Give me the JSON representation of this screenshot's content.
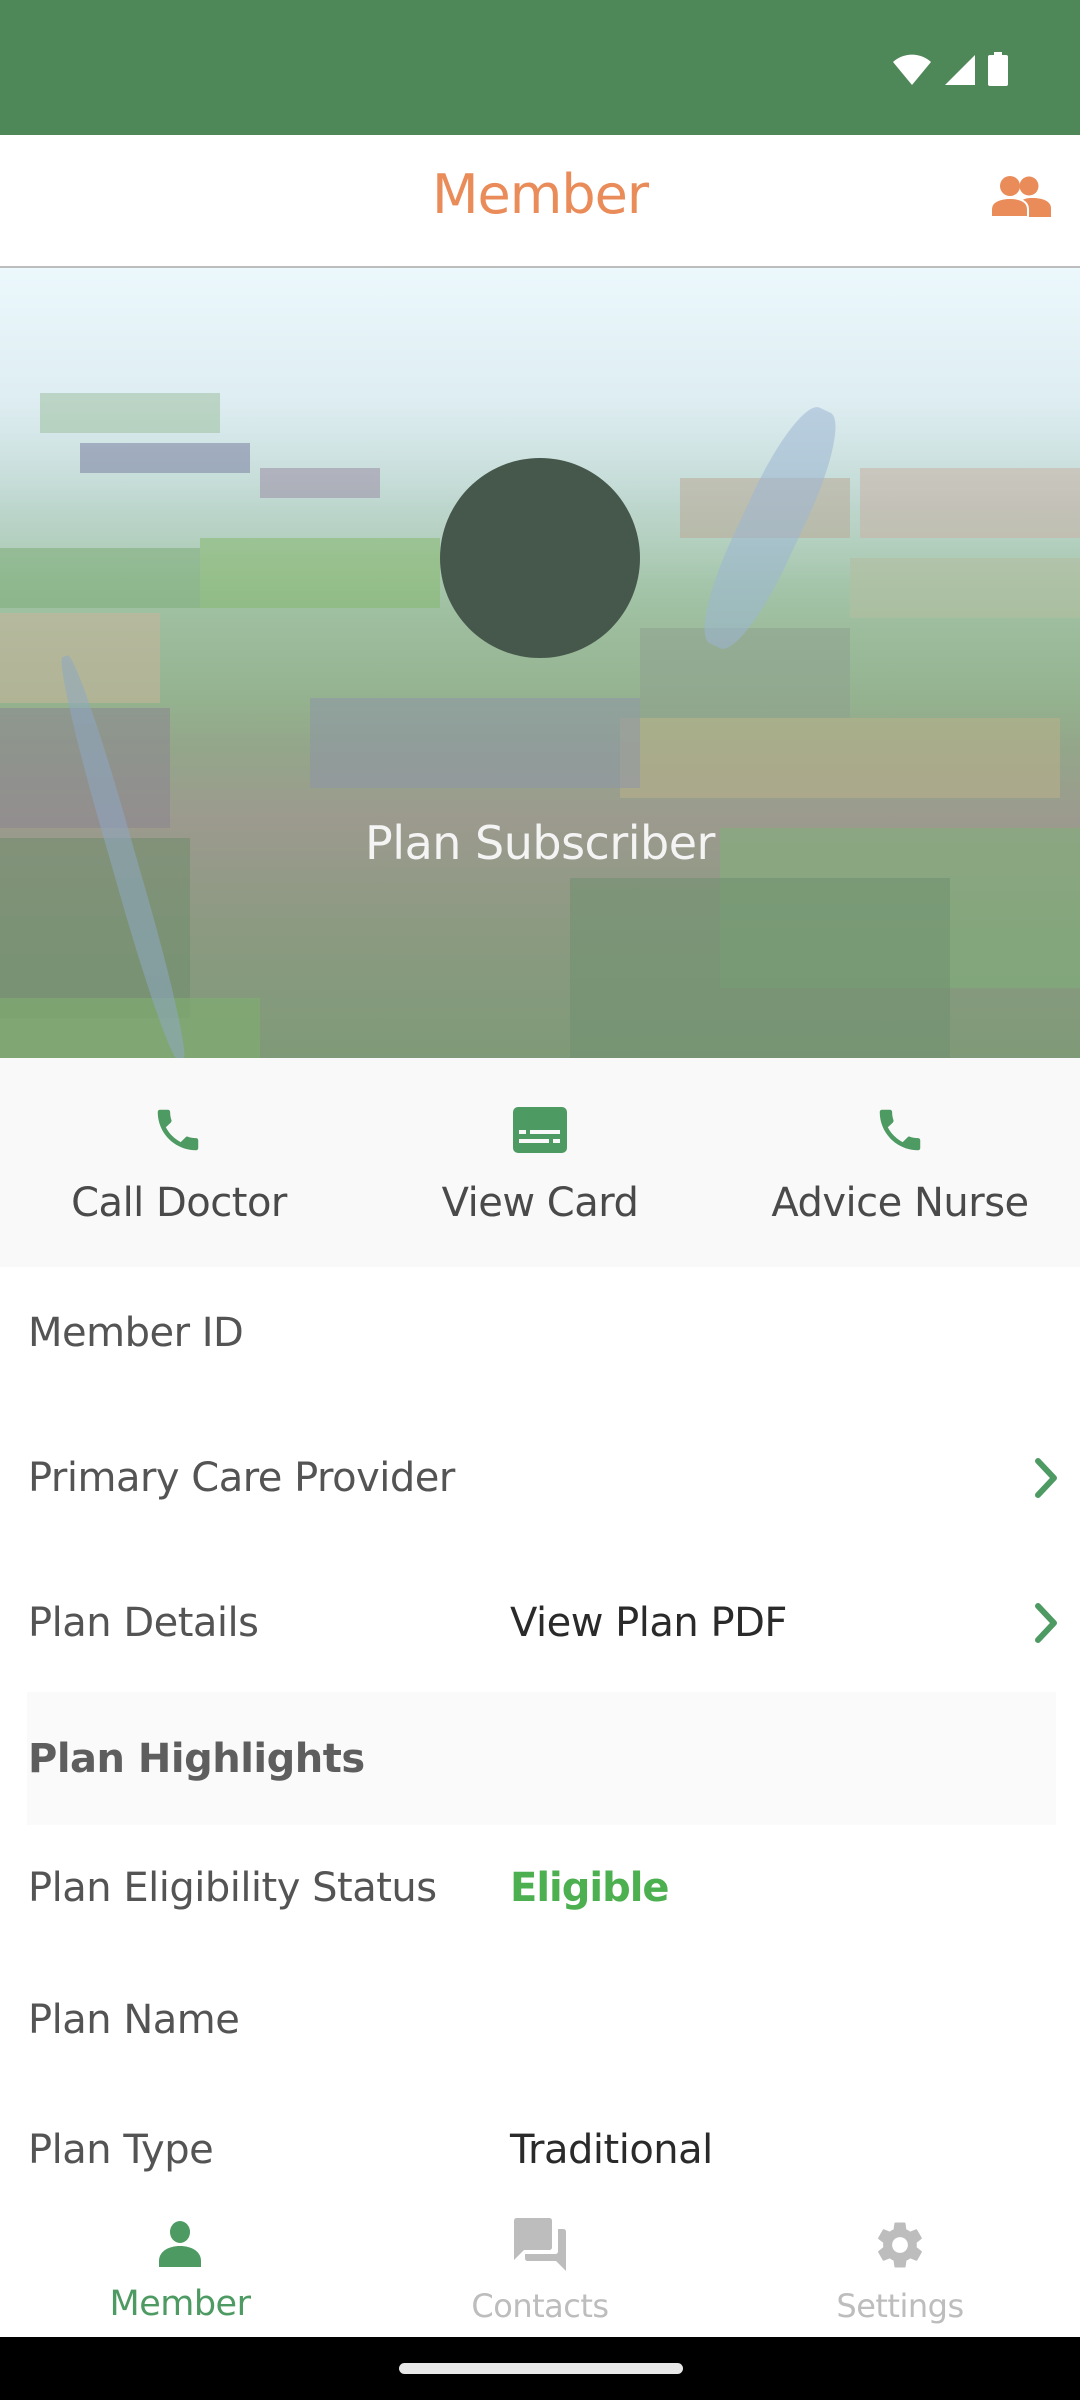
{
  "status_bar": {
    "icons": [
      "wifi-icon",
      "cellular-signal-icon",
      "battery-icon"
    ]
  },
  "header": {
    "title": "Member",
    "right_icon": "family-members-icon"
  },
  "hero": {
    "avatar_color": "#46574C",
    "subscriber_name": "Plan Subscriber"
  },
  "actions": [
    {
      "label": "Call Doctor",
      "icon": "phone-icon"
    },
    {
      "label": "View Card",
      "icon": "card-icon"
    },
    {
      "label": "Advice Nurse",
      "icon": "phone-icon"
    }
  ],
  "details": {
    "member_id": {
      "label": "Member ID",
      "value": ""
    },
    "primary_care_provider": {
      "label": "Primary Care Provider",
      "value": ""
    },
    "plan_details": {
      "label": "Plan Details",
      "value": "View Plan PDF"
    }
  },
  "highlights": {
    "title": "Plan Highlights",
    "eligibility": {
      "label": "Plan Eligibility Status",
      "value": "Eligible"
    },
    "plan_name": {
      "label": "Plan Name",
      "value": ""
    },
    "plan_type": {
      "label": "Plan Type",
      "value": "Traditional"
    }
  },
  "bottom_nav": {
    "items": [
      {
        "label": "Member",
        "icon": "person-icon",
        "active": true
      },
      {
        "label": "Contacts",
        "icon": "chat-icon",
        "active": false
      },
      {
        "label": "Settings",
        "icon": "gear-icon",
        "active": false
      }
    ]
  },
  "colors": {
    "brand_green": "#4E8758",
    "accent_orange": "#E98C59",
    "icon_green": "#4E9A63",
    "eligible_green": "#4CAF50",
    "inactive_gray": "#BDBDBD"
  }
}
